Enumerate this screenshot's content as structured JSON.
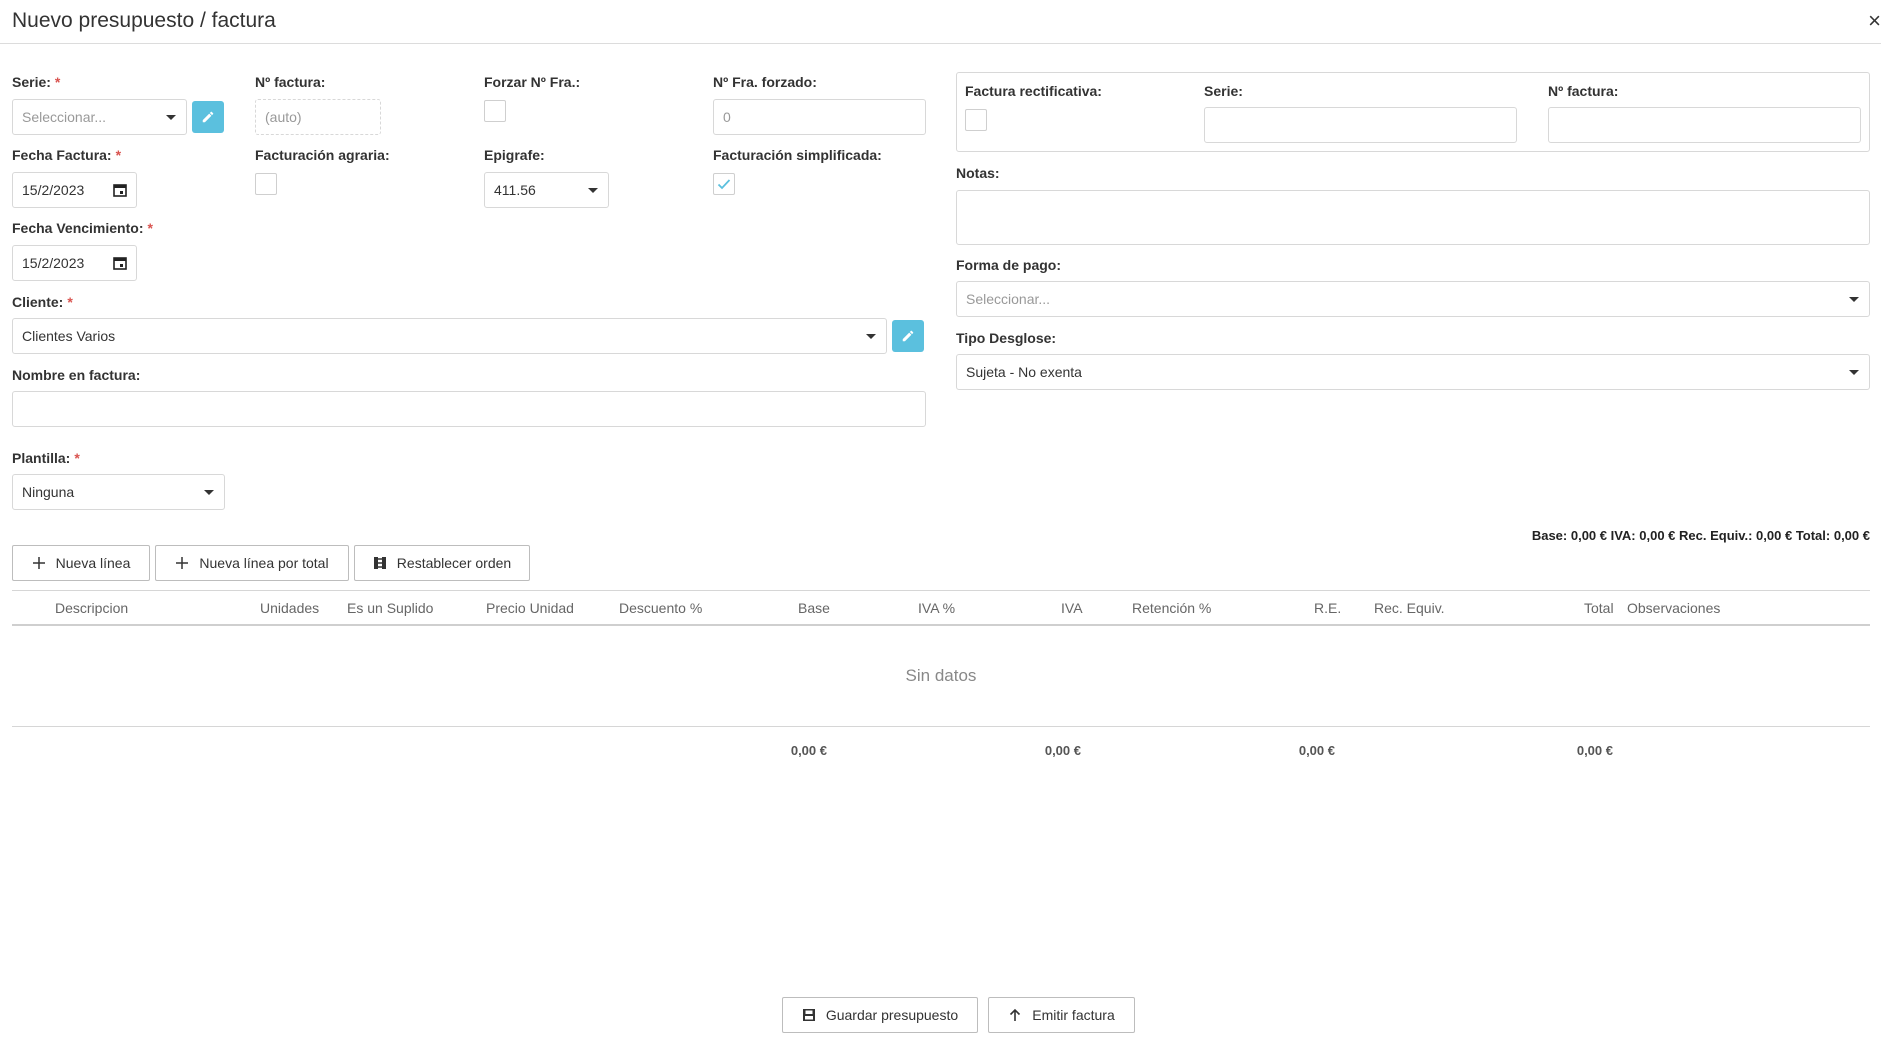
{
  "dialog": {
    "title": "Nuevo presupuesto / factura",
    "close_glyph": "×"
  },
  "required_mark": "*",
  "form": {
    "serie": {
      "label": "Serie:",
      "placeholder": "Seleccionar..."
    },
    "numero_factura": {
      "label": "Nº factura:",
      "placeholder": "(auto)"
    },
    "forzar_numero": {
      "label": "Forzar Nº Fra.:",
      "checked": false
    },
    "numero_forzado": {
      "label": "Nº Fra. forzado:",
      "value": "0"
    },
    "fecha_factura": {
      "label": "Fecha Factura:",
      "value": "15/2/2023"
    },
    "facturacion_agraria": {
      "label": "Facturación agraria:",
      "checked": false
    },
    "epigrafe": {
      "label": "Epigrafe:",
      "value": "411.56"
    },
    "facturacion_simplificada": {
      "label": "Facturación simplificada:",
      "checked": true
    },
    "fecha_vencimiento": {
      "label": "Fecha Vencimiento:",
      "value": "15/2/2023"
    },
    "cliente": {
      "label": "Cliente:",
      "value": "Clientes Varios"
    },
    "nombre_factura": {
      "label": "Nombre en factura:",
      "value": ""
    },
    "plantilla": {
      "label": "Plantilla:",
      "value": "Ninguna"
    }
  },
  "rectificativa": {
    "label": "Factura rectificativa:",
    "checked": false,
    "serie_label": "Serie:",
    "numero_label": "Nº factura:"
  },
  "notas": {
    "label": "Notas:",
    "value": ""
  },
  "forma_pago": {
    "label": "Forma de pago:",
    "placeholder": "Seleccionar..."
  },
  "tipo_desglose": {
    "label": "Tipo Desglose:",
    "value": "Sujeta - No exenta"
  },
  "summary": "Base: 0,00 € IVA: 0,00 € Rec. Equiv.: 0,00 € Total: 0,00 €",
  "toolbar": {
    "nueva_linea": "Nueva línea",
    "nueva_linea_total": "Nueva línea por total",
    "restablecer_orden": "Restablecer orden"
  },
  "table": {
    "columns": [
      "Descripcion",
      "Unidades",
      "Es un Suplido",
      "Precio Unidad",
      "Descuento %",
      "Base",
      "IVA %",
      "IVA",
      "Retención %",
      "R.E.",
      "Rec. Equiv.",
      "Total",
      "Observaciones"
    ],
    "empty_text": "Sin datos",
    "totals": {
      "base": "0,00 €",
      "iva": "0,00 €",
      "re": "0,00 €",
      "total": "0,00 €"
    }
  },
  "footer": {
    "guardar": "Guardar presupuesto",
    "emitir": "Emitir factura"
  },
  "colors": {
    "accent": "#5bc0de",
    "required": "#d9534f",
    "check": "#5bc0de"
  }
}
